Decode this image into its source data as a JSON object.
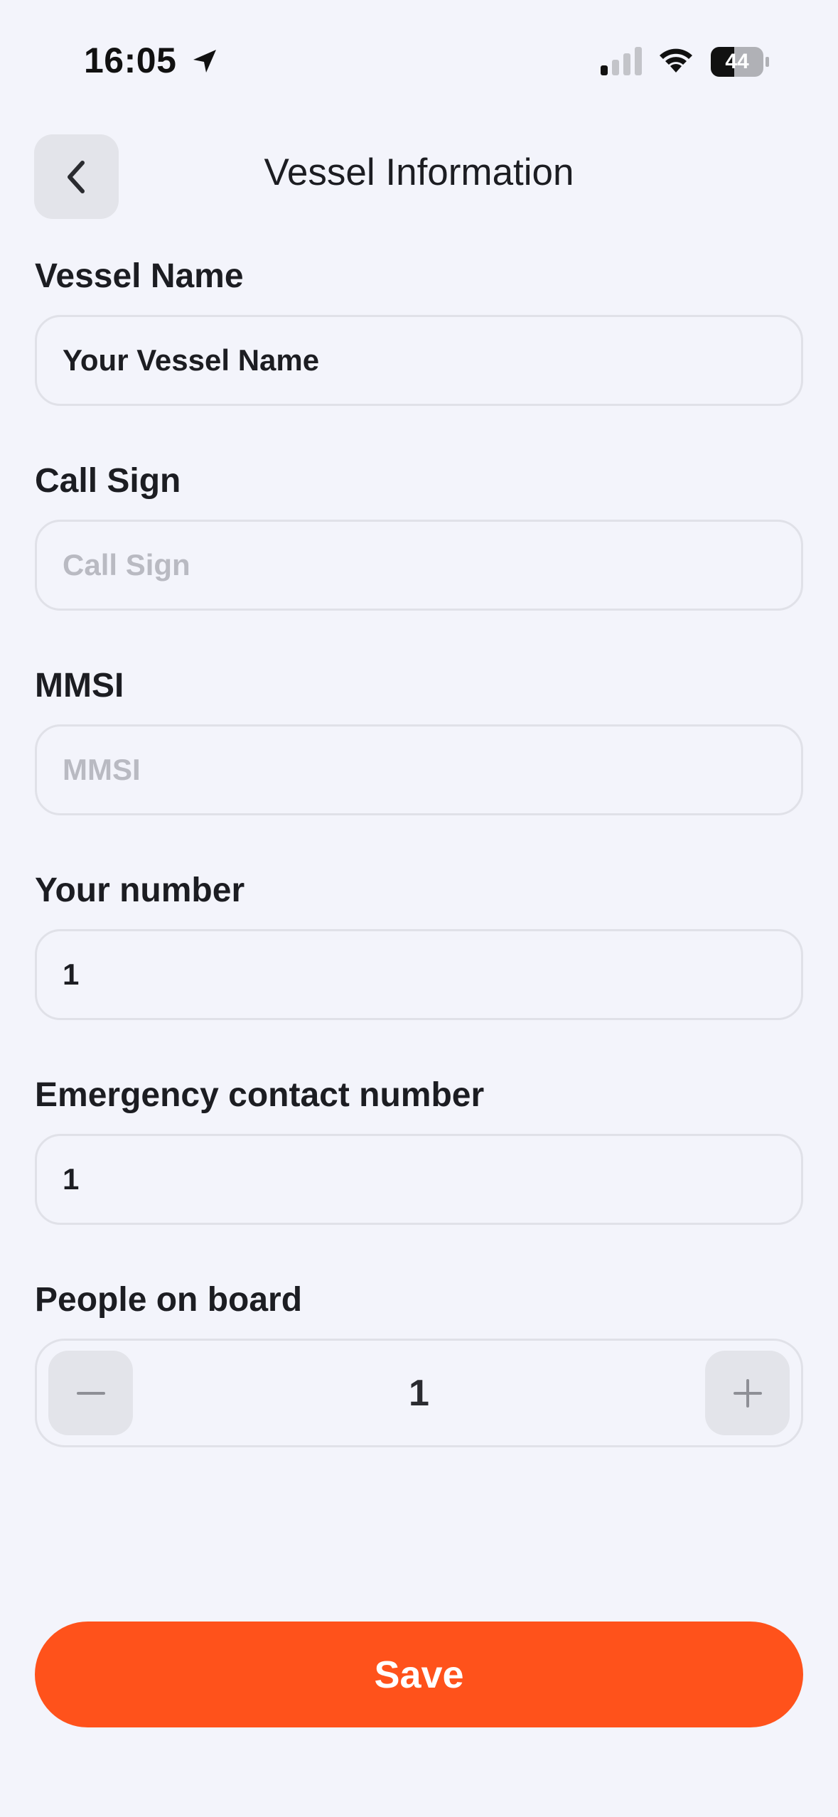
{
  "status_bar": {
    "time": "16:05",
    "battery": "44",
    "icons": [
      "location-arrow-icon",
      "cellular-signal-icon",
      "wifi-icon",
      "battery-icon"
    ]
  },
  "header": {
    "back_icon": "chevron-left-icon",
    "title": "Vessel Information"
  },
  "form": {
    "vessel_name": {
      "label": "Vessel Name",
      "value": "Your Vessel Name",
      "placeholder": ""
    },
    "call_sign": {
      "label": "Call Sign",
      "value": "",
      "placeholder": "Call Sign"
    },
    "mmsi": {
      "label": "MMSI",
      "value": "",
      "placeholder": "MMSI"
    },
    "your_number": {
      "label": "Your number",
      "value": "1",
      "placeholder": ""
    },
    "emergency_number": {
      "label": "Emergency contact number",
      "value": "1",
      "placeholder": ""
    },
    "people_on_board": {
      "label": "People on board",
      "value": "1",
      "minus_icon": "minus-icon",
      "plus_icon": "plus-icon"
    }
  },
  "actions": {
    "save_label": "Save"
  },
  "colors": {
    "background": "#f3f4fb",
    "accent": "#ff521b",
    "button_gray": "#e3e4ea",
    "border": "#e0e1e8",
    "placeholder": "#b9bac2"
  }
}
